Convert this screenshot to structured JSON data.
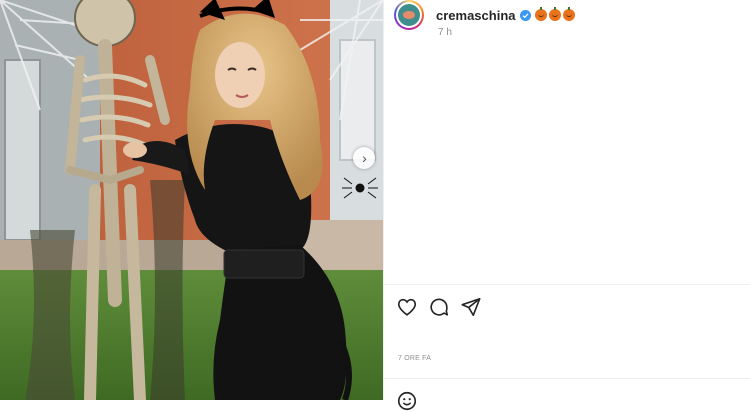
{
  "post": {
    "username": "cremaschina",
    "emojis": [
      "pumpkin-emoji",
      "pumpkin-emoji",
      "pumpkin-emoji"
    ],
    "time_ago": "7 h",
    "date": "7 ORE FA"
  },
  "icons": {
    "like": "heart-icon",
    "comment": "comment-icon",
    "share": "share-icon",
    "carousel_next": "chevron-right-icon",
    "verified": "verified-icon"
  },
  "colors": {
    "accent": "#0095f6",
    "text": "#262626",
    "muted": "#8e8e8e",
    "orange_wall": "#c8673f"
  }
}
